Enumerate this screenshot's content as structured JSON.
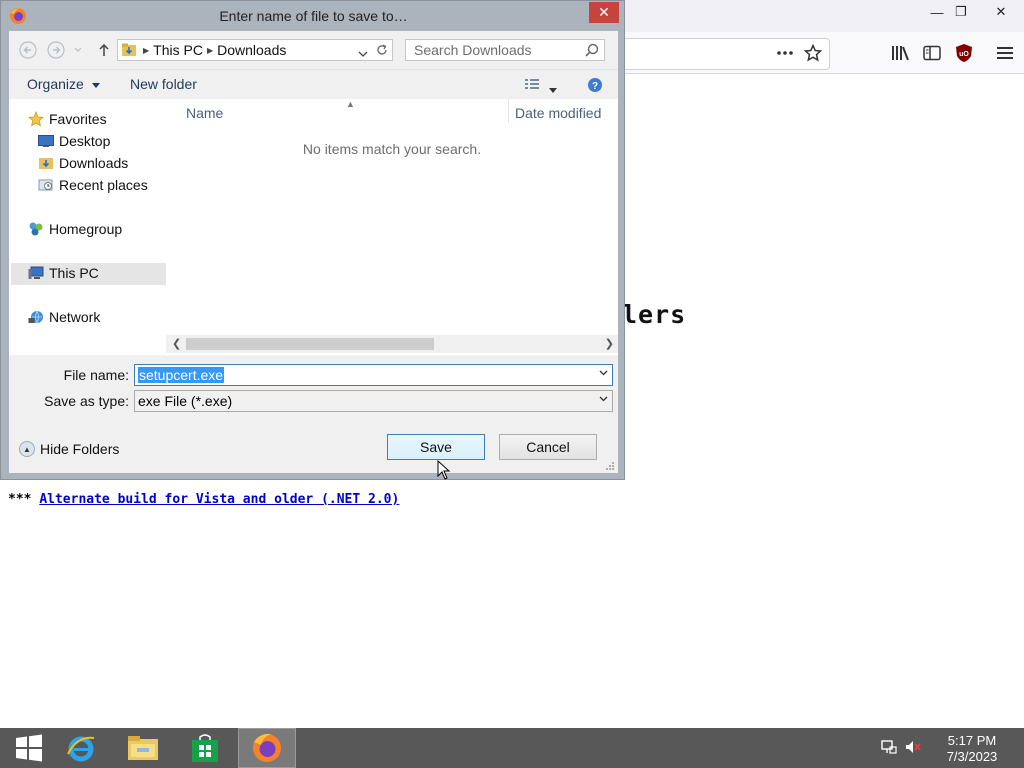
{
  "dialog": {
    "title": "Enter name of file to save to…",
    "close_glyph": "✕",
    "address": {
      "segments": [
        "This PC",
        "Downloads"
      ]
    },
    "search": {
      "placeholder": "Search Downloads"
    },
    "toolbar": {
      "organize": "Organize",
      "new_folder": "New folder"
    },
    "nav": {
      "favorites": "Favorites",
      "desktop": "Desktop",
      "downloads": "Downloads",
      "recent": "Recent places",
      "homegroup": "Homegroup",
      "this_pc": "This PC",
      "network": "Network"
    },
    "columns": {
      "name": "Name",
      "date_modified": "Date modified"
    },
    "empty_message": "No items match your search.",
    "file_name_label": "File name:",
    "file_name_value": "setupcert.exe",
    "save_type_label": "Save as type:",
    "save_type_value": "exe File (*.exe)",
    "hide_folders": "Hide Folders",
    "save": "Save",
    "cancel": "Cancel"
  },
  "page": {
    "heading_fragment": "lers",
    "stars": "***",
    "link_text": "Alternate build for Vista and older (.NET 2.0)"
  },
  "browser": {
    "minimize": "—",
    "restore": "❐",
    "close": "✕"
  },
  "taskbar": {
    "time": "5:17 PM",
    "date": "7/3/2023"
  },
  "colors": {
    "dialog_frame": "#abb3bd",
    "close_red": "#c7443d",
    "taskbar": "#585858",
    "link_blue": "#0000cc",
    "selection": "#3399ff"
  }
}
